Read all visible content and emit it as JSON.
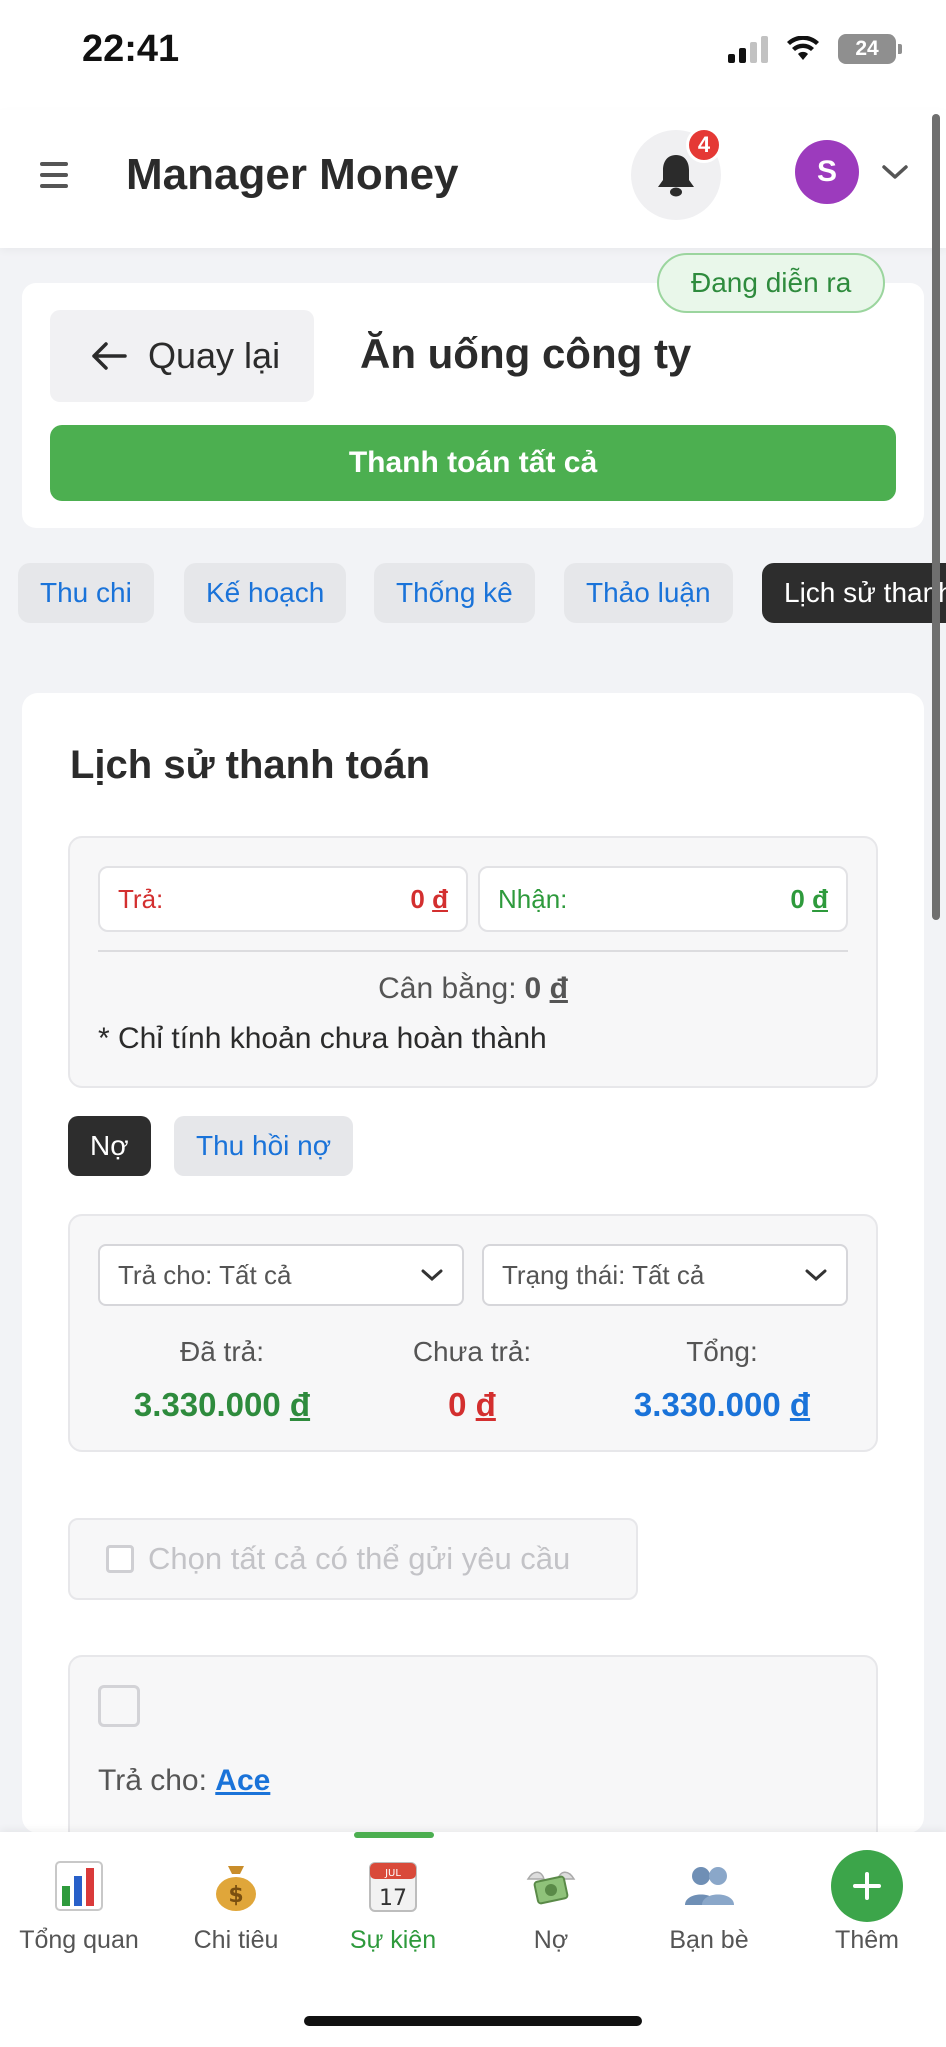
{
  "status_bar": {
    "time": "22:41",
    "battery": "24"
  },
  "header": {
    "title": "Manager Money",
    "notification_count": "4",
    "avatar_initial": "S"
  },
  "event": {
    "status": "Đang diễn ra",
    "back_label": "Quay lại",
    "title": "Ăn uống công ty",
    "pay_all_label": "Thanh toán tất cả"
  },
  "tabs": [
    {
      "label": "Thu chi"
    },
    {
      "label": "Kế hoạch"
    },
    {
      "label": "Thống kê"
    },
    {
      "label": "Thảo luận"
    },
    {
      "label": "Lịch sử thanh toán",
      "active": true
    }
  ],
  "history": {
    "title": "Lịch sử thanh toán",
    "pay_label": "Trả:",
    "pay_value": "0",
    "receive_label": "Nhận:",
    "receive_value": "0",
    "currency": "đ",
    "balance_label": "Cân bằng:",
    "balance_value": "0",
    "note": "* Chỉ tính khoản chưa hoàn thành",
    "toggle_debt": "Nợ",
    "toggle_recover": "Thu hồi nợ",
    "filter_pay_to": "Trả cho: Tất cả",
    "filter_status": "Trạng thái: Tất cả",
    "paid_label": "Đã trả:",
    "paid_value": "3.330.000",
    "unpaid_label": "Chưa trả:",
    "unpaid_value": "0",
    "total_label": "Tổng:",
    "total_value": "3.330.000",
    "select_all_label": "Chọn tất cả có thể gửi yêu cầu",
    "item_payto_label": "Trả cho:",
    "item_payto_name": "Ace"
  },
  "nav": {
    "items": [
      {
        "label": "Tổng quan",
        "icon": "chart-icon"
      },
      {
        "label": "Chi tiêu",
        "icon": "money-bag-icon"
      },
      {
        "label": "Sự kiện",
        "icon": "calendar-icon",
        "active": true
      },
      {
        "label": "Nợ",
        "icon": "money-wings-icon"
      },
      {
        "label": "Bạn bè",
        "icon": "people-icon"
      }
    ],
    "add_label": "Thêm",
    "calendar_month": "JUL",
    "calendar_day": "17"
  },
  "colors": {
    "green": "#4caf50",
    "red": "#d32f2f",
    "blue": "#1a73d9",
    "dark": "#2d2d2d"
  }
}
